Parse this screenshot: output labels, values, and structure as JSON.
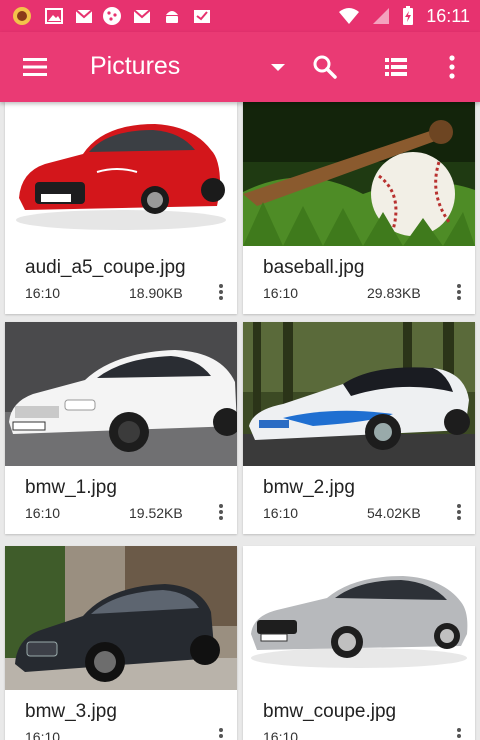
{
  "status_bar": {
    "time": "16:11",
    "notification_icons": [
      "games-icon",
      "image-icon",
      "mail-icon",
      "cookie-icon",
      "mail-icon",
      "android-icon",
      "mail-icon"
    ]
  },
  "app_bar": {
    "title": "Pictures"
  },
  "files": [
    {
      "name": "audi_a5_coupe.jpg",
      "time": "16:10",
      "size": "18.90KB",
      "thumb": "red-car"
    },
    {
      "name": "baseball.jpg",
      "time": "16:10",
      "size": "29.83KB",
      "thumb": "baseball"
    },
    {
      "name": "bmw_1.jpg",
      "time": "16:10",
      "size": "19.52KB",
      "thumb": "white-car"
    },
    {
      "name": "bmw_2.jpg",
      "time": "16:10",
      "size": "54.02KB",
      "thumb": "concept-car"
    },
    {
      "name": "bmw_3.jpg",
      "time": "16:10",
      "size": "",
      "thumb": "black-suv"
    },
    {
      "name": "bmw_coupe.jpg",
      "time": "16:10",
      "size": "",
      "thumb": "silver-car"
    }
  ],
  "colors": {
    "status_bar": "#e7326f",
    "app_bar": "#ea3a74",
    "background": "#e9e9e9"
  }
}
